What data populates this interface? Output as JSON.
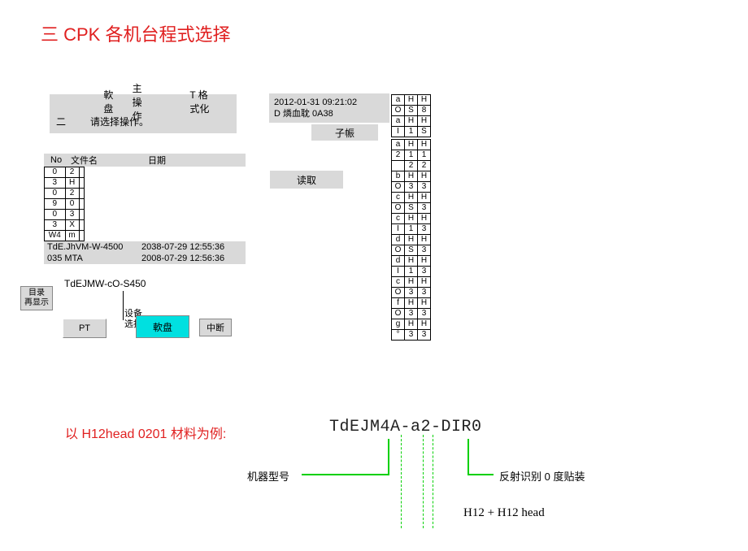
{
  "title": "三 CPK 各机台程式选择",
  "menu": {
    "disk": "軟盘",
    "main_op": "主操作",
    "format": "T 格式化"
  },
  "prompt": {
    "num": "二",
    "text": "请选择操作。"
  },
  "datetime": {
    "line1": "2012-01-31 09:21:02",
    "line2": "D 燐血耽 0A38"
  },
  "buttons": {
    "sub": "子帪",
    "read": "读取",
    "dir1": "目录",
    "dir2": "再显示",
    "pt": "PT",
    "floppy": "軟盘",
    "stop": "中断"
  },
  "filelist": {
    "headers": {
      "no": "No",
      "name": "文件名",
      "date": "日期"
    },
    "left_cells": [
      [
        "0",
        "2",
        " "
      ],
      [
        "3",
        "H",
        " "
      ],
      [
        "0",
        "2",
        " "
      ],
      [
        "9",
        "0",
        " "
      ],
      [
        "0",
        "3",
        " "
      ],
      [
        "3",
        "X",
        " "
      ],
      [
        "W4",
        "m",
        " "
      ]
    ],
    "rows": [
      {
        "name": "TdE.JhVM-W-4500",
        "date": "2038-07-29 12:55:36"
      },
      {
        "name": "035 MTA",
        "date": "2008-07-29 12:56:36"
      }
    ],
    "device_file": "TdEJMW-cO-S450",
    "device_label": "设备选择"
  },
  "side_table": [
    [
      "a",
      "H",
      "H"
    ],
    [
      "O",
      "S",
      "8"
    ],
    [
      "a",
      "H",
      "H"
    ],
    [
      "I",
      "1",
      "S"
    ],
    "gap",
    [
      "a",
      "H",
      "H"
    ],
    [
      "2",
      "1",
      "1"
    ],
    [
      "",
      "2",
      "2"
    ],
    [
      "b",
      "H",
      "H"
    ],
    [
      "O",
      "3",
      "3"
    ],
    [
      "c",
      "H",
      "H"
    ],
    [
      "O",
      "S",
      "3"
    ],
    [
      "c",
      "H",
      "H"
    ],
    [
      "I",
      "1",
      "3"
    ],
    [
      "d",
      "H",
      "H"
    ],
    [
      "O",
      "S",
      "3"
    ],
    [
      "d",
      "H",
      "H"
    ],
    [
      "I",
      "1",
      "3"
    ],
    [
      "c",
      "H",
      "H"
    ],
    [
      "O",
      "3",
      "3"
    ],
    [
      "f",
      "H",
      "H"
    ],
    [
      "O",
      "3",
      "3"
    ],
    [
      "g",
      "H",
      "H"
    ],
    [
      "°",
      "3",
      "3"
    ]
  ],
  "example": {
    "label": "以 H12head 0201 材料为例:",
    "code": "TdEJM4A-a2-DIR0",
    "model_label": "机器型号",
    "reflect_label": "反射识别 0 度贴装",
    "head_label": "H12 + H12 head"
  }
}
